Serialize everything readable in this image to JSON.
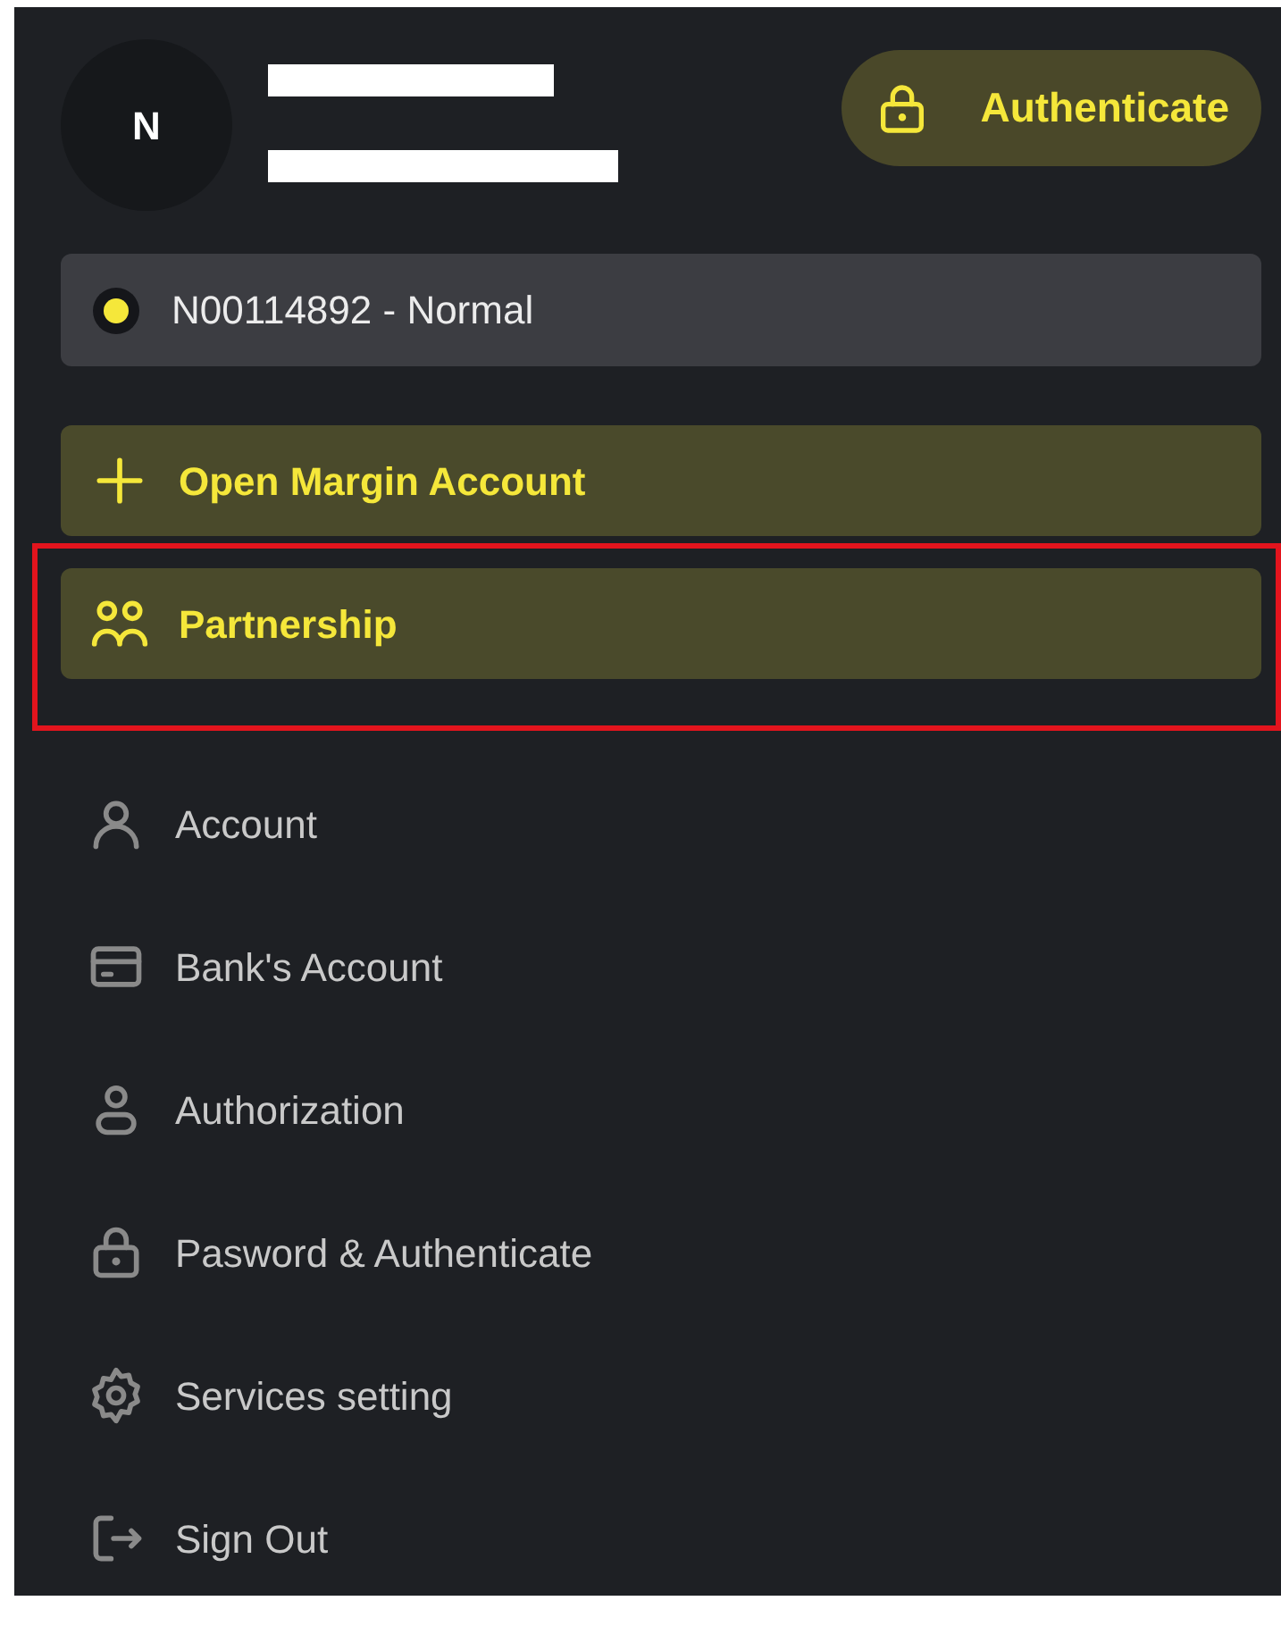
{
  "profile": {
    "initial": "N",
    "name_redacted": true,
    "detail_redacted": true
  },
  "authenticate_button": {
    "label": "Authenticate"
  },
  "account_selector": {
    "label": "N00114892 - Normal",
    "color": "#f5e73a"
  },
  "actions": [
    {
      "label": "Open Margin Account",
      "highlighted": false
    },
    {
      "label": "Partnership",
      "highlighted": true
    }
  ],
  "menu": [
    {
      "label": "Account"
    },
    {
      "label": "Bank's Account"
    },
    {
      "label": "Authorization"
    },
    {
      "label": "Pasword & Authenticate"
    },
    {
      "label": "Services setting"
    },
    {
      "label": "Sign Out"
    }
  ]
}
